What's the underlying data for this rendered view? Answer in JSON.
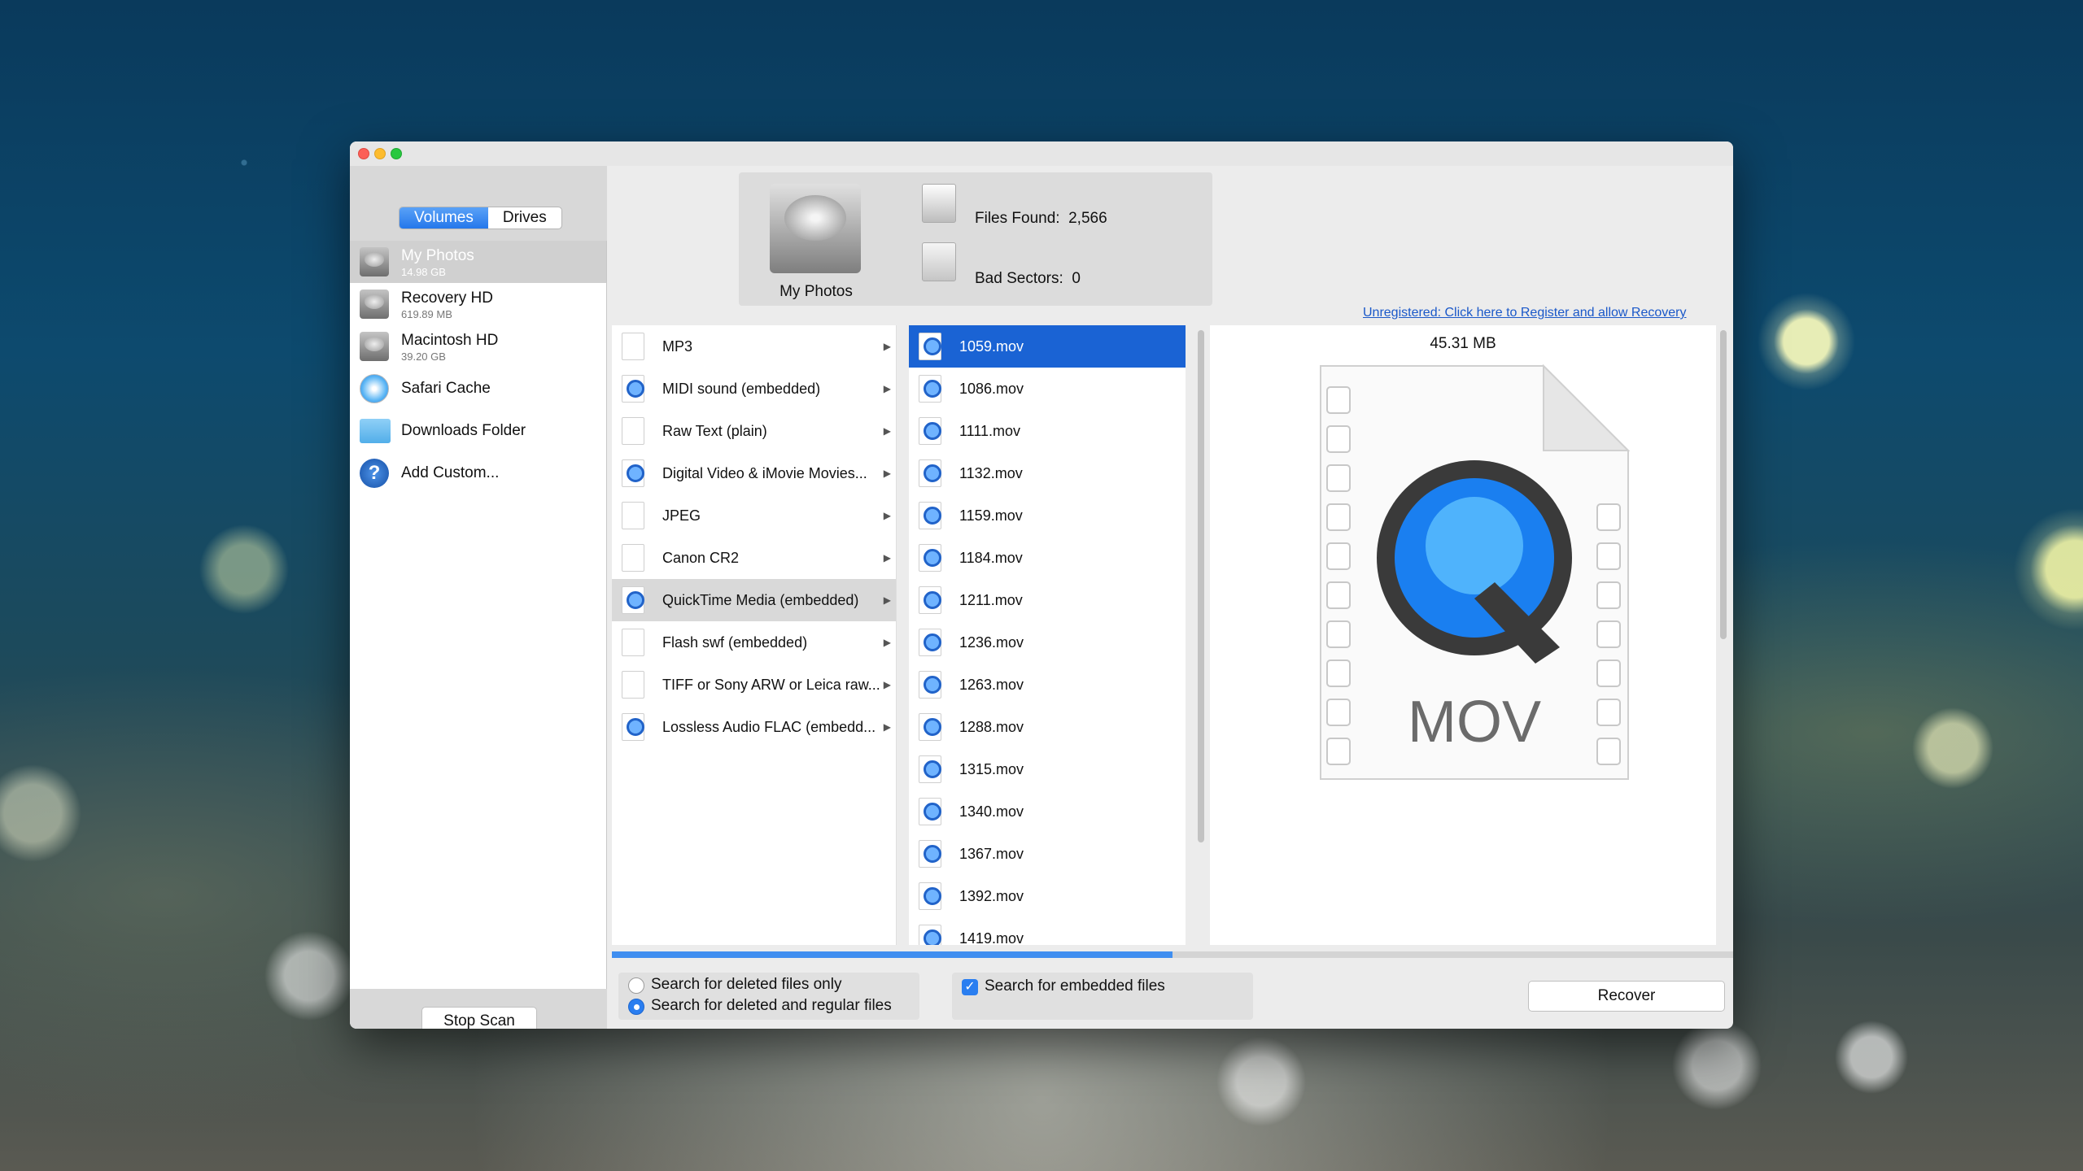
{
  "window": {
    "segments": [
      "Volumes",
      "Drives"
    ],
    "volumes": [
      {
        "name": "My Photos",
        "size": "14.98 GB",
        "icon": "hard-disk-icon",
        "selected": true
      },
      {
        "name": "Recovery HD",
        "size": "619.89 MB",
        "icon": "hard-disk-icon"
      },
      {
        "name": "Macintosh HD",
        "size": "39.20 GB",
        "icon": "hard-disk-icon"
      },
      {
        "name": "Safari Cache",
        "icon": "safari-compass-icon"
      },
      {
        "name": "Downloads Folder",
        "icon": "folder-icon"
      },
      {
        "name": "Add Custom...",
        "icon": "help-icon"
      }
    ],
    "stop_scan": "Stop Scan"
  },
  "header": {
    "volume_name": "My Photos",
    "files_found_label": "Files Found:",
    "files_found_value": "2,566",
    "bad_sectors_label": "Bad Sectors:",
    "bad_sectors_value": "0",
    "register_link": "Unregistered: Click here to Register and allow Recovery"
  },
  "categories": [
    {
      "label": "MP3"
    },
    {
      "label": "MIDI sound (embedded)"
    },
    {
      "label": "Raw Text (plain)"
    },
    {
      "label": "Digital Video & iMovie Movies..."
    },
    {
      "label": "JPEG"
    },
    {
      "label": "Canon CR2"
    },
    {
      "label": "QuickTime Media (embedded)",
      "selected": true
    },
    {
      "label": "Flash swf (embedded)"
    },
    {
      "label": "TIFF or Sony ARW or Leica raw..."
    },
    {
      "label": "Lossless Audio FLAC (embedd..."
    }
  ],
  "files": [
    "1059.mov",
    "1086.mov",
    "1111.mov",
    "1132.mov",
    "1159.mov",
    "1184.mov",
    "1211.mov",
    "1236.mov",
    "1263.mov",
    "1288.mov",
    "1315.mov",
    "1340.mov",
    "1367.mov",
    "1392.mov",
    "1419.mov"
  ],
  "preview": {
    "size": "45.31 MB",
    "file_type_text": "MOV"
  },
  "progress": 0.5,
  "options": {
    "deleted_only": "Search for deleted files only",
    "deleted_and_regular": "Search for deleted and regular files",
    "embedded": "Search for embedded files",
    "recover": "Recover"
  },
  "colors": {
    "accent": "#1a63d4",
    "link": "#1a58c9"
  }
}
